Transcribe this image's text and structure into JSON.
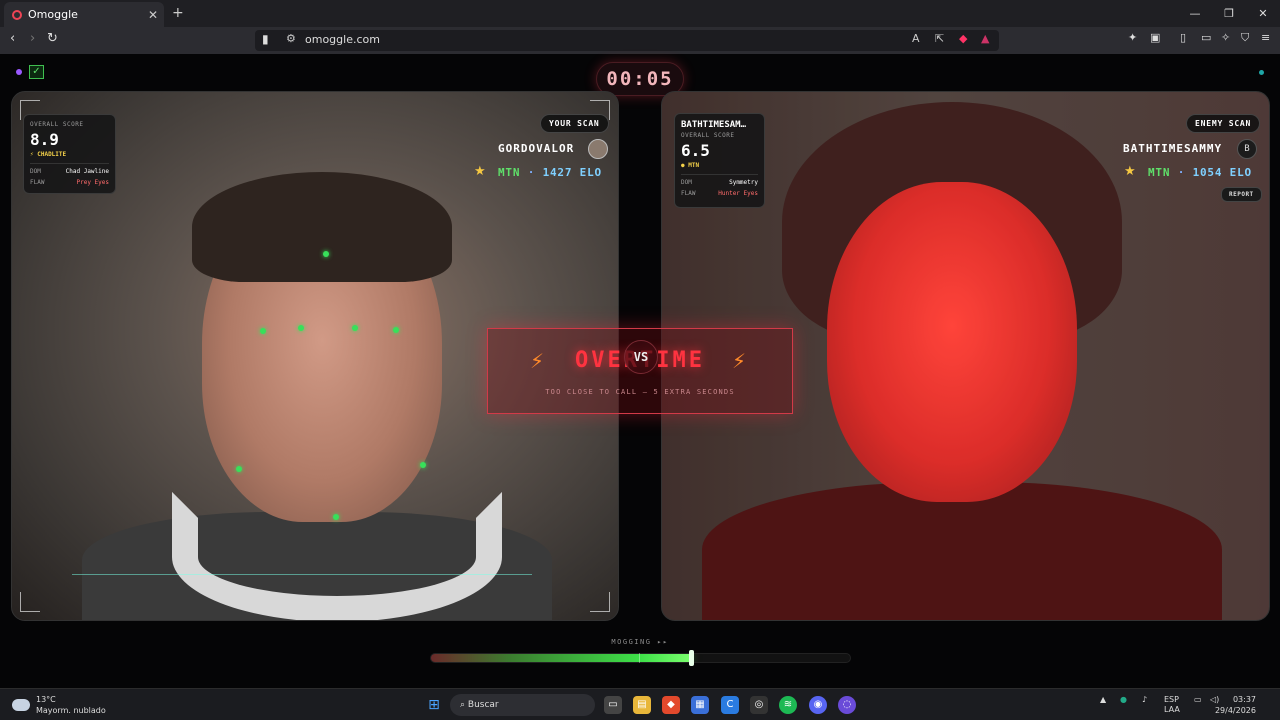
{
  "browser": {
    "tab_title": "Omoggle",
    "url": "omoggle.com",
    "new_tab": "+",
    "tab_close": "✕",
    "win_min": "—",
    "win_max": "❐",
    "win_close": "✕"
  },
  "timer": "00:05",
  "left_player": {
    "scan_label": "YOUR SCAN",
    "username": "GORDOVALOR",
    "tier": "MTN",
    "elo": "1427 ELO",
    "card": {
      "overall_label": "OVERALL SCORE",
      "score": "8.9",
      "tier": "CHADLITE",
      "dom_label": "DOM",
      "dom_value": "Chad Jawline",
      "flaw_label": "FLAW",
      "flaw_value": "Prey Eyes"
    }
  },
  "right_player": {
    "scan_label": "ENEMY SCAN",
    "username": "BATHTIMESAMMY",
    "avatar_letter": "B",
    "tier": "MTN",
    "elo": "1054 ELO",
    "report": "REPORT",
    "card": {
      "name": "BATHTIMESAM…",
      "overall_label": "OVERALL SCORE",
      "score": "6.5",
      "tier": "MTN",
      "dom_label": "DOM",
      "dom_value": "Symmetry",
      "flaw_label": "FLAW",
      "flaw_value": "Hunter Eyes"
    }
  },
  "overtime": {
    "title": "OVERTIME",
    "subtitle": "TOO CLOSE TO CALL — 5 EXTRA SECONDS",
    "vs": "VS"
  },
  "mog_meter": {
    "label": "MOGGING ▸▸",
    "value": 0.62
  },
  "taskbar": {
    "temp": "13°C",
    "weather": "Mayorm. nublado",
    "search": "Buscar",
    "lang1": "ESP",
    "lang2": "LAA",
    "time": "03:37",
    "date": "29/4/2026"
  },
  "colors": {
    "accent_green": "#3de048",
    "accent_red": "#ff3340",
    "tier_gold": "#f5d24a"
  }
}
